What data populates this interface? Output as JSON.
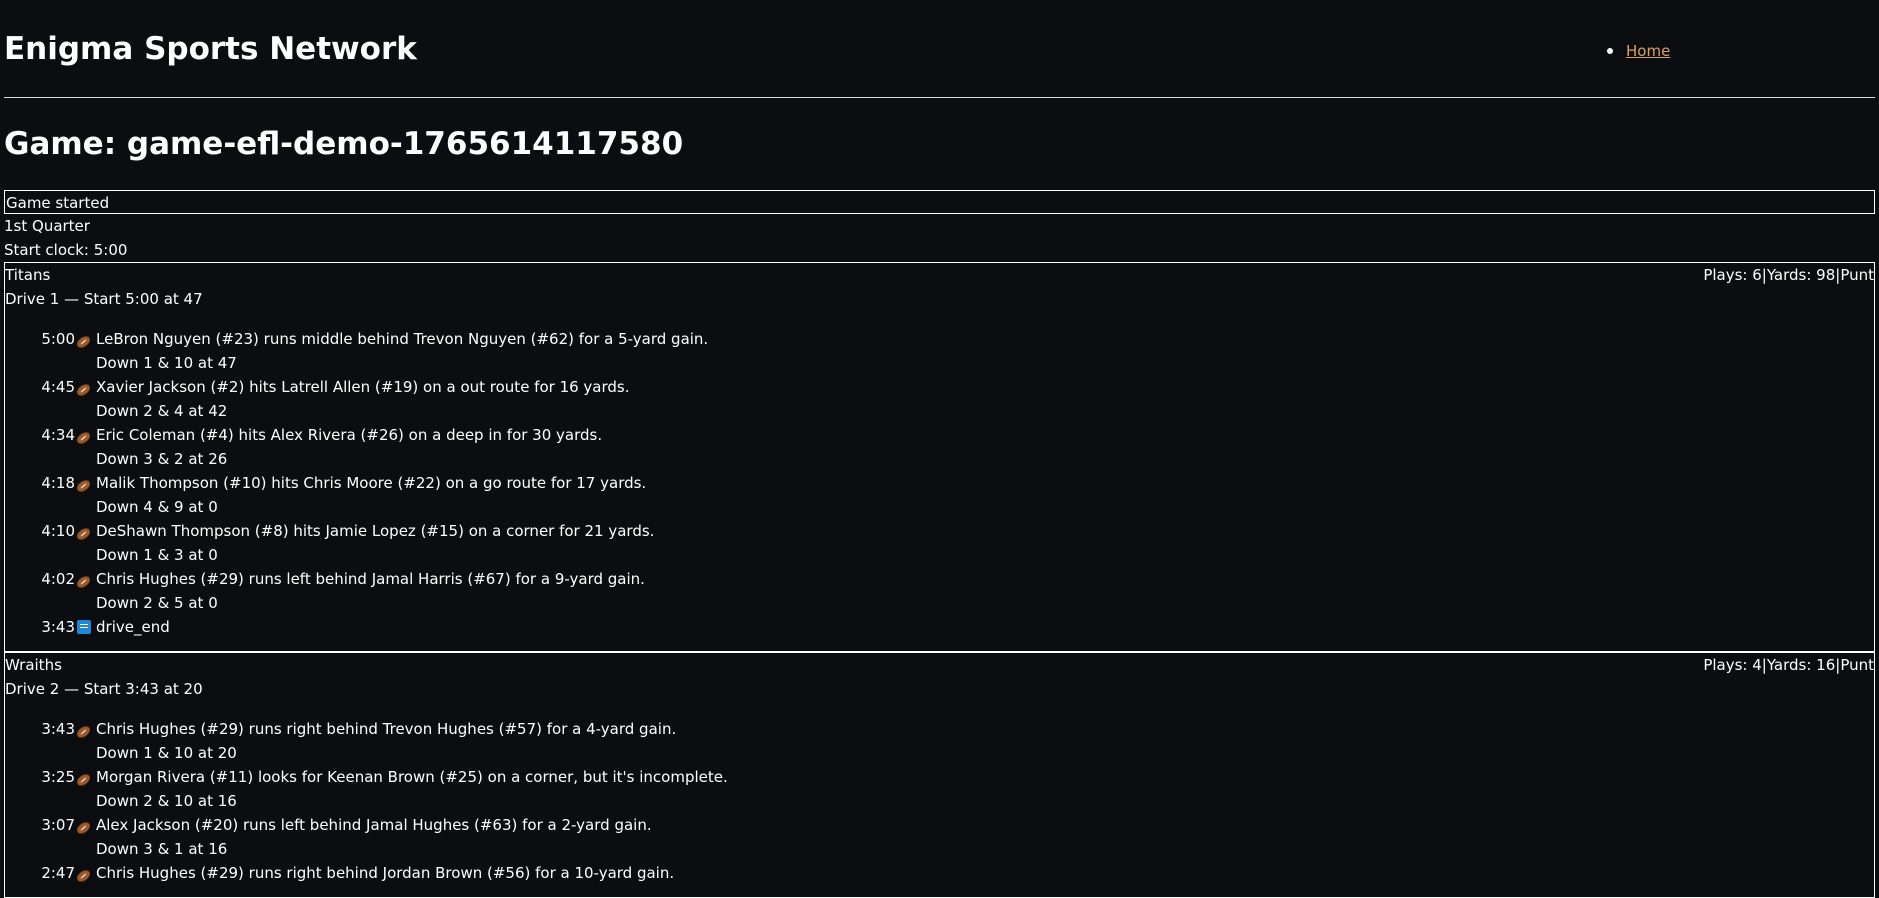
{
  "site": {
    "title": "Enigma Sports Network",
    "nav": [
      {
        "label": "Home"
      }
    ]
  },
  "game": {
    "title": "Game: game-efl-demo-1765614117580",
    "status": "Game started",
    "quarter": "1st Quarter",
    "start_clock": "Start clock: 5:00"
  },
  "drives": [
    {
      "team": "Titans",
      "stats": "Plays: 6|Yards: 98|Punt",
      "subtitle": "Drive 1 — Start 5:00 at 47",
      "plays": [
        {
          "time": "5:00",
          "icon": "football-icon",
          "text": "LeBron Nguyen (#23) runs middle behind Trevon Nguyen (#62) for a 5-yard gain.",
          "down": "Down 1 & 10 at 47"
        },
        {
          "time": "4:45",
          "icon": "football-icon",
          "text": "Xavier Jackson (#2) hits Latrell Allen (#19) on a out route for 16 yards.",
          "down": "Down 2 & 4 at 42"
        },
        {
          "time": "4:34",
          "icon": "football-icon",
          "text": "Eric Coleman (#4) hits Alex Rivera (#26) on a deep in for 30 yards.",
          "down": "Down 3 & 2 at 26"
        },
        {
          "time": "4:18",
          "icon": "football-icon",
          "text": "Malik Thompson (#10) hits Chris Moore (#22) on a go route for 17 yards.",
          "down": "Down 4 & 9 at 0"
        },
        {
          "time": "4:10",
          "icon": "football-icon",
          "text": "DeShawn Thompson (#8) hits Jamie Lopez (#15) on a corner for 21 yards.",
          "down": "Down 1 & 3 at 0"
        },
        {
          "time": "4:02",
          "icon": "football-icon",
          "text": "Chris Hughes (#29) runs left behind Jamal Harris (#67) for a 9-yard gain.",
          "down": "Down 2 & 5 at 0"
        },
        {
          "time": "3:43",
          "icon": "end-icon",
          "text": "drive_end",
          "down": ""
        }
      ]
    },
    {
      "team": "Wraiths",
      "stats": "Plays: 4|Yards: 16|Punt",
      "subtitle": "Drive 2 — Start 3:43 at 20",
      "plays": [
        {
          "time": "3:43",
          "icon": "football-icon",
          "text": "Chris Hughes (#29) runs right behind Trevon Hughes (#57) for a 4-yard gain.",
          "down": "Down 1 & 10 at 20"
        },
        {
          "time": "3:25",
          "icon": "football-icon",
          "text": "Morgan Rivera (#11) looks for Keenan Brown (#25) on a corner, but it's incomplete.",
          "down": "Down 2 & 10 at 16"
        },
        {
          "time": "3:07",
          "icon": "football-icon",
          "text": "Alex Jackson (#20) runs left behind Jamal Hughes (#63) for a 2-yard gain.",
          "down": "Down 3 & 1 at 16"
        },
        {
          "time": "2:47",
          "icon": "football-icon",
          "text": "Chris Hughes (#29) runs right behind Jordan Brown (#56) for a 10-yard gain.",
          "down": ""
        }
      ]
    }
  ]
}
